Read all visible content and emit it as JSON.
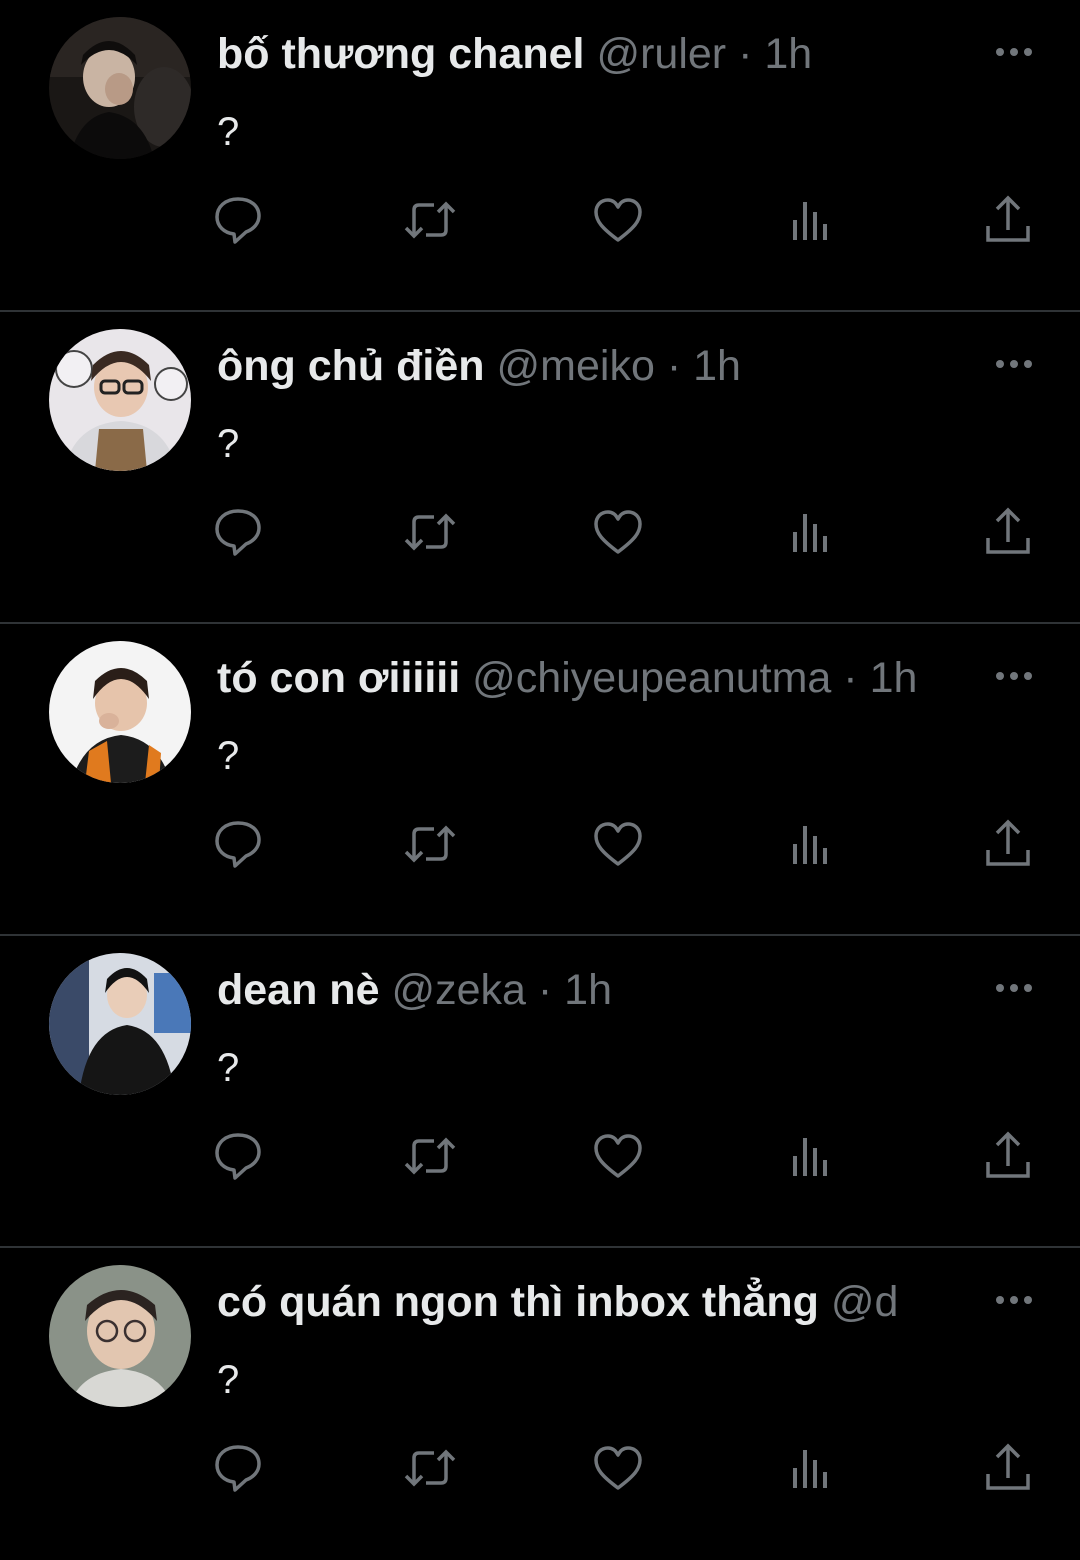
{
  "theme": {
    "background": "#000000",
    "name_color": "#e7e9ea",
    "meta_color": "#71767b",
    "divider_color": "#2f3336"
  },
  "action_icons": [
    "reply-icon",
    "retweet-icon",
    "like-icon",
    "views-icon",
    "share-icon"
  ],
  "tweets": [
    {
      "display_name": "bố thương chanel",
      "handle": "@ruler",
      "separator": "·",
      "time": "1h",
      "text": "?",
      "avatar_icon": "avatar-photo"
    },
    {
      "display_name": "ông chủ điền",
      "handle": "@meiko",
      "separator": "·",
      "time": "1h",
      "text": "?",
      "avatar_icon": "avatar-photo"
    },
    {
      "display_name": "tó con ơiiiiii",
      "handle": "@chiyeupeanutma",
      "separator": "·",
      "time": "1h",
      "text": "?",
      "avatar_icon": "avatar-photo"
    },
    {
      "display_name": "dean nè",
      "handle": "@zeka",
      "separator": "·",
      "time": "1h",
      "text": "?",
      "avatar_icon": "avatar-photo"
    },
    {
      "display_name": "có quán ngon thì inbox thẳng",
      "handle": "@d",
      "separator": "",
      "time": "",
      "text": "?",
      "avatar_icon": "avatar-photo"
    }
  ]
}
